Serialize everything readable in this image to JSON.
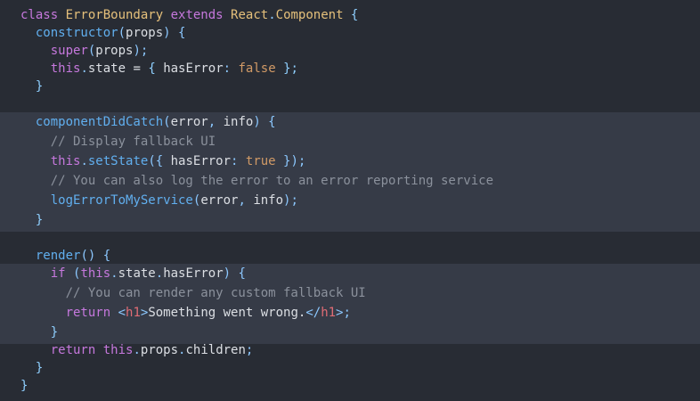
{
  "editor": {
    "lines": [
      [
        {
          "t": "class ",
          "k": "kw"
        },
        {
          "t": "ErrorBoundary",
          "k": "cls"
        },
        {
          "t": " ",
          "k": ""
        },
        {
          "t": "extends",
          "k": "kw"
        },
        {
          "t": " ",
          "k": ""
        },
        {
          "t": "React",
          "k": "cls"
        },
        {
          "t": ".",
          "k": "punc"
        },
        {
          "t": "Component",
          "k": "cls"
        },
        {
          "t": " {",
          "k": "brace"
        }
      ],
      [
        {
          "t": "  constructor",
          "k": "fn"
        },
        {
          "t": "(",
          "k": "punc"
        },
        {
          "t": "props",
          "k": ""
        },
        {
          "t": ") {",
          "k": "punc"
        }
      ],
      [
        {
          "t": "    super",
          "k": "kw"
        },
        {
          "t": "(",
          "k": "punc"
        },
        {
          "t": "props",
          "k": ""
        },
        {
          "t": ");",
          "k": "punc"
        }
      ],
      [
        {
          "t": "    this",
          "k": "kw"
        },
        {
          "t": ".",
          "k": "punc"
        },
        {
          "t": "state",
          "k": ""
        },
        {
          "t": " = ",
          "k": ""
        },
        {
          "t": "{",
          "k": "brace"
        },
        {
          "t": " hasError",
          "k": ""
        },
        {
          "t": ": ",
          "k": "punc"
        },
        {
          "t": "false",
          "k": "bool"
        },
        {
          "t": " };",
          "k": "brace"
        }
      ],
      [
        {
          "t": "  }",
          "k": "brace"
        }
      ],
      [],
      [
        {
          "t": "  componentDidCatch",
          "k": "fn"
        },
        {
          "t": "(",
          "k": "punc"
        },
        {
          "t": "error",
          "k": ""
        },
        {
          "t": ", ",
          "k": "punc"
        },
        {
          "t": "info",
          "k": ""
        },
        {
          "t": ") {",
          "k": "punc"
        }
      ],
      [
        {
          "t": "    // Display fallback UI",
          "k": "cm"
        }
      ],
      [
        {
          "t": "    this",
          "k": "kw"
        },
        {
          "t": ".",
          "k": "punc"
        },
        {
          "t": "setState",
          "k": "fn"
        },
        {
          "t": "({",
          "k": "punc"
        },
        {
          "t": " hasError",
          "k": ""
        },
        {
          "t": ": ",
          "k": "punc"
        },
        {
          "t": "true",
          "k": "bool"
        },
        {
          "t": " });",
          "k": "punc"
        }
      ],
      [
        {
          "t": "    // You can also log the error to an error reporting service",
          "k": "cm"
        }
      ],
      [
        {
          "t": "    logErrorToMyService",
          "k": "fn"
        },
        {
          "t": "(",
          "k": "punc"
        },
        {
          "t": "error",
          "k": ""
        },
        {
          "t": ", ",
          "k": "punc"
        },
        {
          "t": "info",
          "k": ""
        },
        {
          "t": ");",
          "k": "punc"
        }
      ],
      [
        {
          "t": "  }",
          "k": "brace"
        }
      ],
      [],
      [
        {
          "t": "  render",
          "k": "fn"
        },
        {
          "t": "() {",
          "k": "punc"
        }
      ],
      [
        {
          "t": "    if",
          "k": "kw"
        },
        {
          "t": " (",
          "k": "punc"
        },
        {
          "t": "this",
          "k": "kw"
        },
        {
          "t": ".",
          "k": "punc"
        },
        {
          "t": "state",
          "k": ""
        },
        {
          "t": ".",
          "k": "punc"
        },
        {
          "t": "hasError",
          "k": ""
        },
        {
          "t": ") {",
          "k": "punc"
        }
      ],
      [
        {
          "t": "      // You can render any custom fallback UI",
          "k": "cm"
        }
      ],
      [
        {
          "t": "      return",
          "k": "kw"
        },
        {
          "t": " <",
          "k": "punc"
        },
        {
          "t": "h1",
          "k": "tag"
        },
        {
          "t": ">",
          "k": "punc"
        },
        {
          "t": "Something went wrong.",
          "k": ""
        },
        {
          "t": "</",
          "k": "punc"
        },
        {
          "t": "h1",
          "k": "tag"
        },
        {
          "t": ">;",
          "k": "punc"
        }
      ],
      [
        {
          "t": "    }",
          "k": "brace"
        }
      ],
      [
        {
          "t": "    return",
          "k": "kw"
        },
        {
          "t": " this",
          "k": "kw"
        },
        {
          "t": ".",
          "k": "punc"
        },
        {
          "t": "props",
          "k": ""
        },
        {
          "t": ".",
          "k": "punc"
        },
        {
          "t": "children",
          "k": ""
        },
        {
          "t": ";",
          "k": "punc"
        }
      ],
      [
        {
          "t": "  }",
          "k": "brace"
        }
      ],
      [
        {
          "t": "}",
          "k": "brace"
        }
      ]
    ]
  }
}
